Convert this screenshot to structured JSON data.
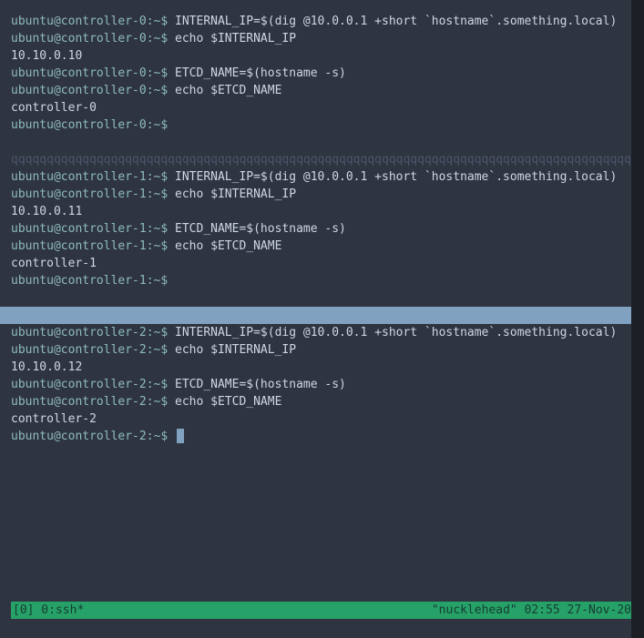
{
  "panes": [
    {
      "prompt": "ubuntu@controller-0:~$",
      "lines": [
        {
          "type": "cmd",
          "cmd": "INTERNAL_IP=$(dig @10.0.0.1 +short `hostname`.something.local)"
        },
        {
          "type": "cmd",
          "cmd": "echo $INTERNAL_IP"
        },
        {
          "type": "out",
          "text": "10.10.0.10"
        },
        {
          "type": "cmd",
          "cmd": "ETCD_NAME=$(hostname -s)"
        },
        {
          "type": "cmd",
          "cmd": "echo $ETCD_NAME"
        },
        {
          "type": "out",
          "text": "controller-0"
        },
        {
          "type": "cmd",
          "cmd": ""
        }
      ],
      "divider_active": false
    },
    {
      "prompt": "ubuntu@controller-1:~$",
      "lines": [
        {
          "type": "cmd",
          "cmd": "INTERNAL_IP=$(dig @10.0.0.1 +short `hostname`.something.local)"
        },
        {
          "type": "cmd",
          "cmd": "echo $INTERNAL_IP"
        },
        {
          "type": "out",
          "text": "10.10.0.11"
        },
        {
          "type": "cmd",
          "cmd": "ETCD_NAME=$(hostname -s)"
        },
        {
          "type": "cmd",
          "cmd": "echo $ETCD_NAME"
        },
        {
          "type": "out",
          "text": "controller-1"
        },
        {
          "type": "cmd",
          "cmd": ""
        }
      ],
      "divider_active": true
    },
    {
      "prompt": "ubuntu@controller-2:~$",
      "lines": [
        {
          "type": "cmd",
          "cmd": "INTERNAL_IP=$(dig @10.0.0.1 +short `hostname`.something.local)"
        },
        {
          "type": "cmd",
          "cmd": "echo $INTERNAL_IP"
        },
        {
          "type": "out",
          "text": "10.10.0.12"
        },
        {
          "type": "cmd",
          "cmd": "ETCD_NAME=$(hostname -s)"
        },
        {
          "type": "cmd",
          "cmd": "echo $ETCD_NAME"
        },
        {
          "type": "out",
          "text": "controller-2"
        },
        {
          "type": "cmd",
          "cmd": "",
          "cursor": true
        }
      ],
      "divider_active": null
    }
  ],
  "divider_char": "q",
  "status": {
    "left": "[0] 0:ssh*",
    "right": "\"nucklehead\" 02:55 27-Nov-20"
  }
}
